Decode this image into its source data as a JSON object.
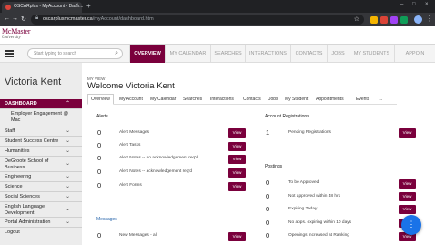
{
  "browser": {
    "tab_title": "OSCARplus - MyAccount - Dash...",
    "tab_close": "×",
    "new_tab": "+",
    "url_host": "oscarplusmcmaster.ca",
    "url_path": "/myAccount/dashboard.htm",
    "win_min": "–",
    "win_max": "□",
    "win_close": "×",
    "back": "←",
    "forward": "→",
    "reload": "↻",
    "star": "☆",
    "menu": "⋮"
  },
  "site": {
    "logo_line1": "McMaster",
    "logo_line2": "University",
    "search_placeholder": "Start typing to search",
    "nav_tabs": [
      "OVERVIEW",
      "MY CALENDAR",
      "SEARCHES",
      "INTERACTIONS",
      "CONTACTS",
      "JOBS",
      "MY STUDENTS",
      "APPOIN"
    ]
  },
  "sidebar": {
    "user_name": "Victoria Kent",
    "items": [
      {
        "label": "DASHBOARD",
        "active": true
      },
      {
        "label": "Staff"
      },
      {
        "label": "Student Success Centre"
      },
      {
        "label": "Humanities"
      },
      {
        "label": "DeGroote School of"
      },
      {
        "label": "Engineering"
      },
      {
        "label": "Science"
      },
      {
        "label": "Social Sciences"
      },
      {
        "label": "English Language"
      },
      {
        "label": "Portal Administration"
      },
      {
        "label": "Logout"
      }
    ],
    "sub_employer_1": "Employer Engagement @",
    "sub_employer_2": "Mac",
    "degroote_2": "Business",
    "english_2": "Development",
    "chevron": "⌄",
    "chevron_up": "⌃"
  },
  "main": {
    "my_view": "MY VIEW",
    "welcome": "Welcome Victoria Kent",
    "subtabs": [
      "Overview",
      "My Account",
      "My Calendar",
      "Searches",
      "Interactions",
      "Contacts",
      "Jobs",
      "My Student",
      "Appointments",
      "Events",
      "..."
    ],
    "alerts_heading": "Alerts",
    "alerts": [
      {
        "count": "0",
        "label": "Alert Messages"
      },
      {
        "count": "0",
        "label": "Alert Tasks"
      },
      {
        "count": "0",
        "label": "Alert Notes -- no acknowledgement req'd"
      },
      {
        "count": "0",
        "label": "Alert Notes -- acknowledgement req'd"
      },
      {
        "count": "0",
        "label": "Alert Forms"
      }
    ],
    "messages_heading": "Messages",
    "messages": [
      {
        "count": "0",
        "label": "New Messages - all"
      }
    ],
    "acct_heading": "Account Registrations",
    "acct": [
      {
        "count": "1",
        "label": "Pending Registrations"
      }
    ],
    "postings_heading": "Postings",
    "postings": [
      {
        "count": "0",
        "label": "To be Approved"
      },
      {
        "count": "0",
        "label": "Not approved within 48 hrs"
      },
      {
        "count": "0",
        "label": "Expiring Today"
      },
      {
        "count": "0",
        "label": "No apps. expiring within 10 days"
      },
      {
        "count": "0",
        "label": "Openings increased at Ranking"
      }
    ],
    "view_label": "View",
    "fab_dots": "⋮"
  },
  "colors": {
    "brand": "#7a003c",
    "fab": "#1a73e8"
  }
}
